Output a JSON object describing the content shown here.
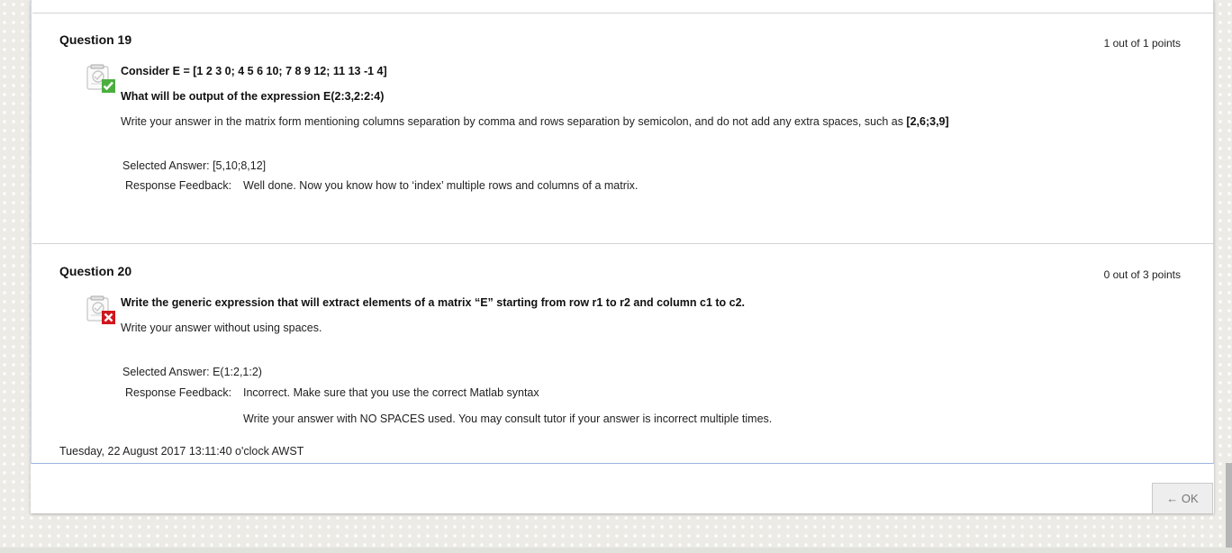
{
  "questions": [
    {
      "title": "Question 19",
      "points": "1 out of 1 points",
      "status_icon": "correct-check-icon",
      "line1": "Consider E = [1 2 3 0; 4 5 6 10; 7 8 9 12; 11 13 -1 4]",
      "line2": "What will be output of the expression E(2:3,2:2:4)",
      "line3_text": "Write your answer in the matrix form mentioning columns separation by comma and rows separation by semicolon, and do not add any extra spaces, such as ",
      "line3_example": "[2,6;3,9]",
      "selected_answer_label": "Selected Answer:",
      "selected_answer_value": "[5,10;8,12]",
      "feedback_label": "Response Feedback:",
      "feedback": [
        "Well done. Now you know how to ‘index’ multiple rows and columns of a matrix."
      ]
    },
    {
      "title": "Question 20",
      "points": "0 out of 3 points",
      "status_icon": "incorrect-x-icon",
      "line1": "Write the generic expression that will extract elements of a matrix “E” starting from row r1 to r2 and column c1 to c2.",
      "line2": "Write your answer without using spaces.",
      "selected_answer_label": "Selected Answer:",
      "selected_answer_value": "E(1:2,1:2)",
      "feedback_label": "Response Feedback:",
      "feedback": [
        "Incorrect. Make sure that you use the correct Matlab syntax",
        "Write your answer with NO SPACES used. You may consult tutor if your answer is incorrect multiple times."
      ]
    }
  ],
  "timestamp": "Tuesday, 22 August 2017 13:11:40 o'clock AWST",
  "ok_button": "← OK",
  "colors": {
    "correct": "#4cae3f",
    "incorrect": "#d0161d",
    "frame_border": "#9bb4e0"
  }
}
